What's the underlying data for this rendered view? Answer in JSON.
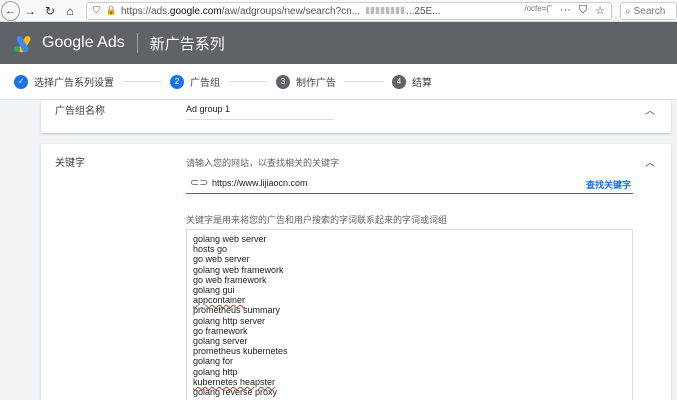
{
  "browser": {
    "url_prefix": "https://ads.",
    "url_domain": "google.com",
    "url_path": "/aw/adgroups/new/search?cn...",
    "url_trailing": "...25E...",
    "url_right_fragment": "/ocfe={\"",
    "search_placeholder": "Search"
  },
  "header": {
    "product": "Google Ads",
    "campaign_title": "新广告系列"
  },
  "stepper": {
    "steps": [
      {
        "num": "✓",
        "label": "选择广告系列设置"
      },
      {
        "num": "2",
        "label": "广告组"
      },
      {
        "num": "3",
        "label": "制作广告"
      },
      {
        "num": "4",
        "label": "结算"
      }
    ]
  },
  "adgroup": {
    "label": "广告组名称",
    "value": "Ad group 1"
  },
  "keywords": {
    "label": "关键字",
    "hint": "请输入您的网站，以查找相关的关键字",
    "url": "https://www.lijiaocn.com",
    "search_button": "查找关键字",
    "desc": "关键字是用来将您的广告和用户搜索的字词联系起来的字词或词组",
    "list": [
      "golang web server",
      "hosts go",
      "go web server",
      "golang web framework",
      "go web framework",
      "golang gui",
      "appcontainer",
      "prometheus summary",
      "golang http server",
      "go framework",
      "golang server",
      "prometheus kubernetes",
      "golang for",
      "golang http",
      "kubernetes heapster",
      "golang reverse proxy"
    ]
  },
  "icons": {
    "collapse": "chevron-up-icon",
    "link": "link-icon"
  }
}
